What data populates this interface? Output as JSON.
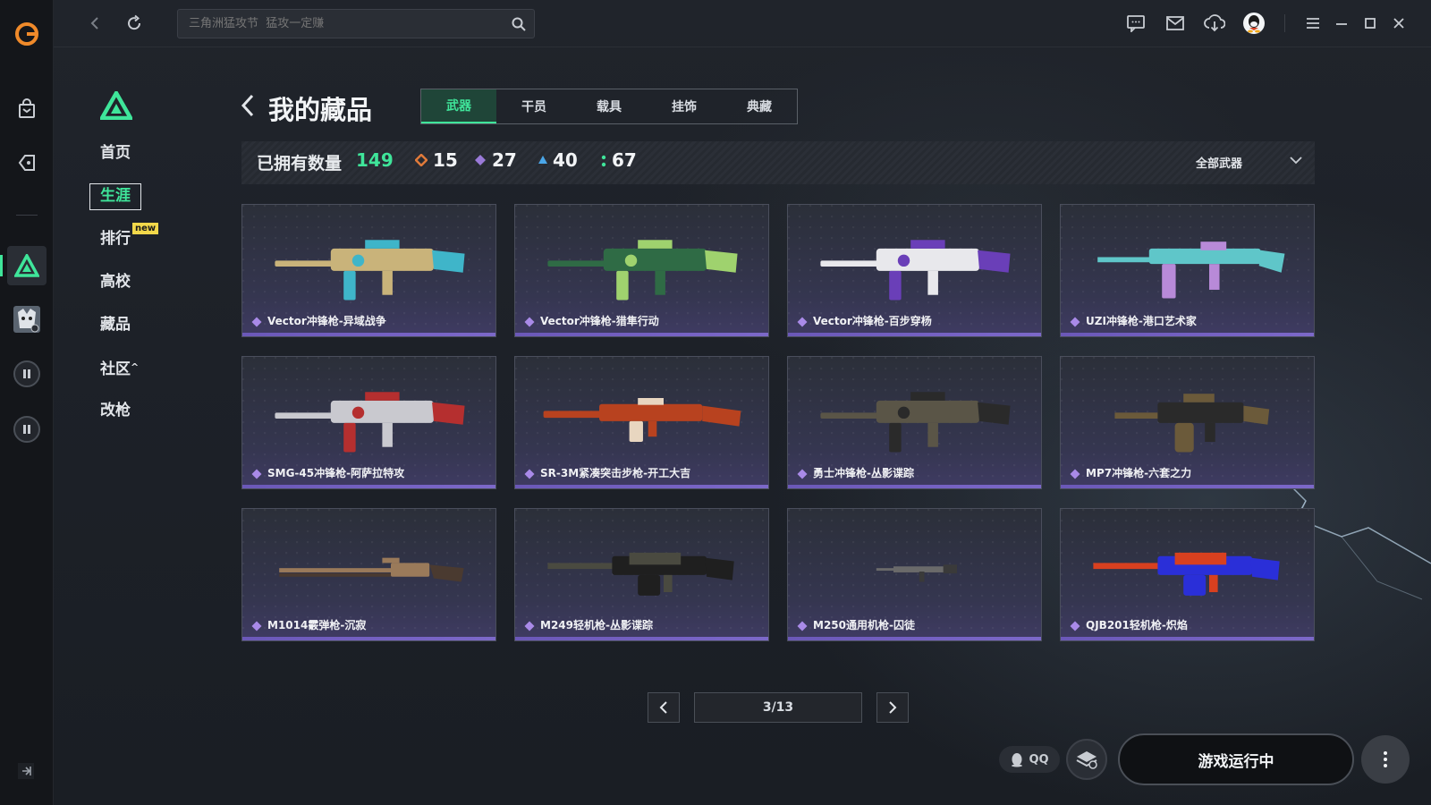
{
  "search": {
    "placeholder": "三角洲猛攻节  猛攻一定赚"
  },
  "sidebar": {
    "items": [
      {
        "label": "首页"
      },
      {
        "label": "生涯"
      },
      {
        "label": "排行"
      },
      {
        "label": "高校"
      },
      {
        "label": "藏品"
      },
      {
        "label": "社区"
      },
      {
        "label": "改枪"
      }
    ],
    "new_badge": "new",
    "community_caret": "^"
  },
  "header": {
    "title": "我的藏品",
    "tabs": [
      {
        "label": "武器"
      },
      {
        "label": "干员"
      },
      {
        "label": "载具"
      },
      {
        "label": "挂饰"
      },
      {
        "label": "典藏"
      }
    ]
  },
  "stats": {
    "owned_label": "已拥有数量",
    "owned_total": "149",
    "counts": [
      {
        "value": "15",
        "color": "#e07a3a"
      },
      {
        "value": "27",
        "color": "#9a7ad8"
      },
      {
        "value": "40",
        "color": "#4aa6e8"
      },
      {
        "value": "67",
        "color": "#3fe59a"
      }
    ],
    "filter_label": "全部武器"
  },
  "items": [
    {
      "name": "Vector冲锋枪-异域战争",
      "accent": "#c9b37a",
      "accent2": "#3fb5c9"
    },
    {
      "name": "Vector冲锋枪-猎隼行动",
      "accent": "#2f6b45",
      "accent2": "#9fd26e"
    },
    {
      "name": "Vector冲锋枪-百步穿杨",
      "accent": "#e8e8ec",
      "accent2": "#6a3fb8"
    },
    {
      "name": "UZI冲锋枪-港口艺术家",
      "accent": "#5fc6c9",
      "accent2": "#b88ad8"
    },
    {
      "name": "SMG-45冲锋枪-阿萨拉特攻",
      "accent": "#c9c9cf",
      "accent2": "#b52f2f"
    },
    {
      "name": "SR-3M紧凑突击步枪-开工大吉",
      "accent": "#b8421f",
      "accent2": "#e8d6c0"
    },
    {
      "name": "勇士冲锋枪-丛影谍踪",
      "accent": "#5a5547",
      "accent2": "#2a2a2a"
    },
    {
      "name": "MP7冲锋枪-六套之力",
      "accent": "#6b5a3a",
      "accent2": "#2a2a2a"
    },
    {
      "name": "M1014霰弹枪-沉寂",
      "accent": "#9a7a5a",
      "accent2": "#4a3a30"
    },
    {
      "name": "M249轻机枪-丛影谍踪",
      "accent": "#4a4a40",
      "accent2": "#1f1f1f"
    },
    {
      "name": "M250通用机枪-囚徒",
      "accent": "#6a6a6a",
      "accent2": "#3a3a3a"
    },
    {
      "name": "QJB201轻机枪-炽焰",
      "accent": "#d8401f",
      "accent2": "#2a2fd8"
    }
  ],
  "pagination": {
    "current": "3/13"
  },
  "bottom": {
    "qq_label": "QQ",
    "game_status": "游戏运行中"
  }
}
